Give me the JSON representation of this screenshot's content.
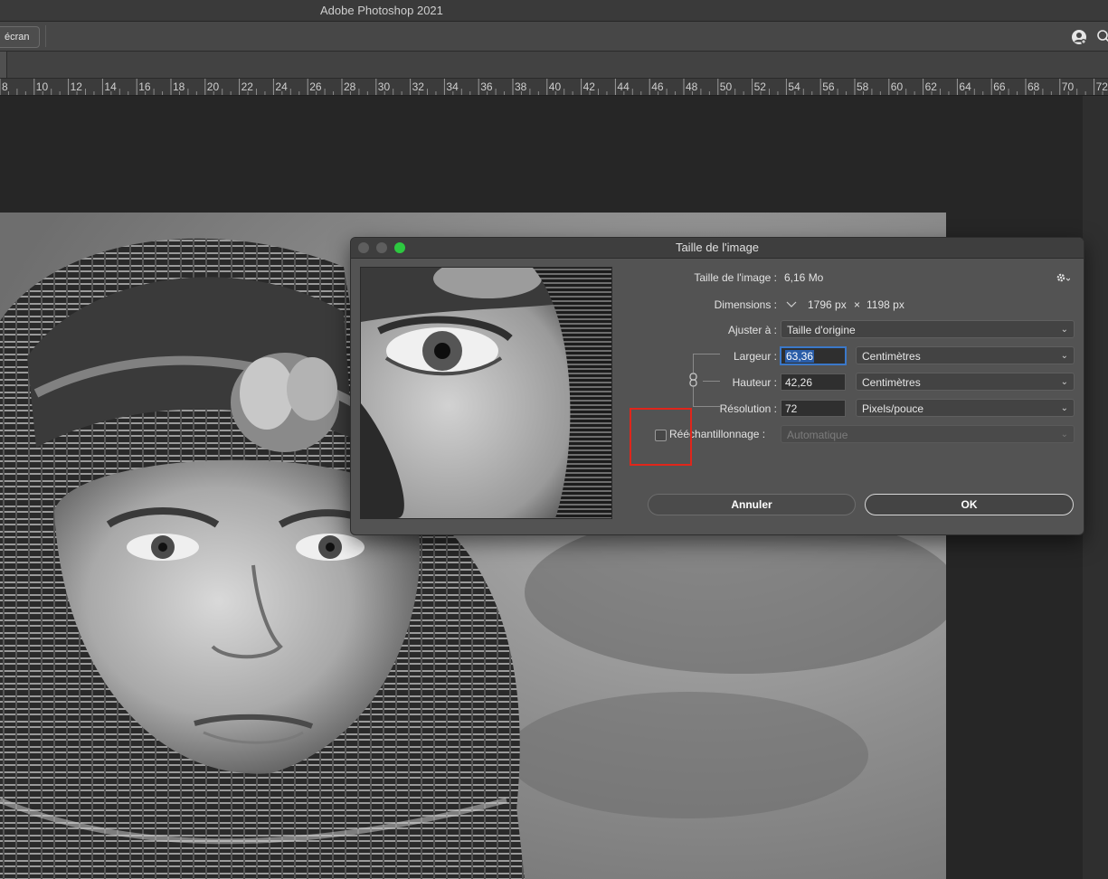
{
  "app": {
    "title": "Adobe Photoshop 2021"
  },
  "options_bar": {
    "screen_button": "écran",
    "icons": [
      "user-icon",
      "search-icon"
    ]
  },
  "ruler": {
    "labels": [
      "8",
      "10",
      "12",
      "14",
      "16",
      "18",
      "20",
      "22",
      "24",
      "26",
      "28",
      "30",
      "32",
      "34",
      "36",
      "38",
      "40",
      "42",
      "44",
      "46",
      "48",
      "50",
      "52",
      "54",
      "56",
      "58",
      "60",
      "62",
      "64",
      "66",
      "68",
      "70",
      "72"
    ]
  },
  "dialog": {
    "title": "Taille de l'image",
    "image_size_label": "Taille de l'image :",
    "image_size_value": "6,16 Mo",
    "dimensions_label": "Dimensions :",
    "dimensions_width": "1796 px",
    "dimensions_times": "×",
    "dimensions_height": "1198 px",
    "fit_label": "Ajuster à :",
    "fit_value": "Taille d'origine",
    "width_label": "Largeur :",
    "width_value": "63,36",
    "width_unit": "Centimètres",
    "height_label": "Hauteur :",
    "height_value": "42,26",
    "height_unit": "Centimètres",
    "resolution_label": "Résolution :",
    "resolution_value": "72",
    "resolution_unit": "Pixels/pouce",
    "resample_label": "Rééchantillonnage :",
    "resample_checked": false,
    "resample_value": "Automatique",
    "cancel_label": "Annuler",
    "ok_label": "OK"
  },
  "colors": {
    "accent": "#3b78c9",
    "highlight": "#e0261b",
    "zoom_light": "#2dc840"
  }
}
